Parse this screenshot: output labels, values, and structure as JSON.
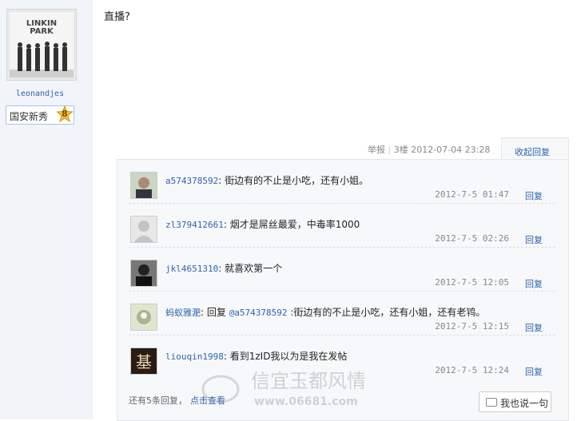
{
  "user": {
    "avatar_text_top": "LINKIN",
    "avatar_text_bottom": "PARK",
    "name": "leonandjes",
    "rank_label": "国安新秀",
    "rank_level": "8"
  },
  "post": {
    "text": "直播?",
    "report_label": "举报",
    "floor": "3楼",
    "datetime": "2012-07-04 23:28",
    "collapse_label": "收起回复"
  },
  "replies": [
    {
      "name": "a574378592",
      "text": "街边有的不止是小吃，还有小姐。",
      "time": "2012-7-5 01:47",
      "reply_label": "回复"
    },
    {
      "name": "zl379412661",
      "text": "烟才是屌丝最爱，中毒率1000",
      "time": "2012-7-5 02:26",
      "reply_label": "回复"
    },
    {
      "name": "jkl4651310",
      "text": "就喜欢第一个",
      "time": "2012-7-5 12:05",
      "reply_label": "回复"
    },
    {
      "name": "蚂蚁雅淝",
      "text_prefix": "回复 ",
      "mention": "@a574378592",
      "text": ":街边有的不止是小吃，还有小姐，还有老鸨。",
      "time": "2012-7-5 12:15",
      "reply_label": "回复"
    },
    {
      "name": "liouqin1998",
      "text": "看到1zID我以为是我在发帖",
      "time": "2012-7-5 12:24",
      "reply_label": "回复"
    }
  ],
  "footer": {
    "more_text": "还有5条回复，",
    "more_link": "点击查看",
    "say_button": "我也说一句"
  },
  "watermark": {
    "title": "信宜玉都风情",
    "url": "www.06681.com"
  }
}
